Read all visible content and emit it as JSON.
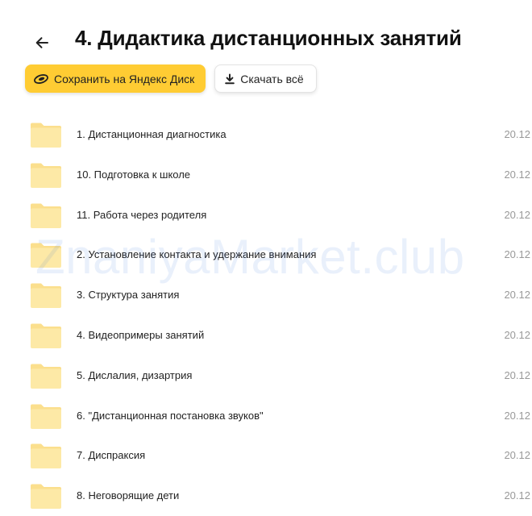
{
  "header": {
    "back_icon": "arrow-left-icon",
    "title": "4. Дидактика дистанционных занятий"
  },
  "toolbar": {
    "save_label": "Сохранить на Яндекс Диск",
    "save_icon": "yandex-disk-icon",
    "download_label": "Скачать всё",
    "download_icon": "download-icon"
  },
  "files": [
    {
      "name": "1. Дистанционная диагностика",
      "date": "20.12"
    },
    {
      "name": "10. Подготовка к школе",
      "date": "20.12"
    },
    {
      "name": "11. Работа через родителя",
      "date": "20.12"
    },
    {
      "name": "2. Установление контакта и удержание внимания",
      "date": "20.12"
    },
    {
      "name": "3. Структура занятия",
      "date": "20.12"
    },
    {
      "name": "4. Видеопримеры занятий",
      "date": "20.12"
    },
    {
      "name": "5. Дислалия, дизартрия",
      "date": "20.12"
    },
    {
      "name": "6. \"Дистанционная постановка звуков\"",
      "date": "20.12"
    },
    {
      "name": "7. Диспраксия",
      "date": "20.12"
    },
    {
      "name": "8. Неговорящие дети",
      "date": "20.12"
    }
  ],
  "watermark": "ZnaniyaMarket.club",
  "colors": {
    "accent": "#ffcc33",
    "folder_fill": "#fde9a6",
    "folder_tab": "#fbdf8d",
    "date_text": "#999999"
  }
}
